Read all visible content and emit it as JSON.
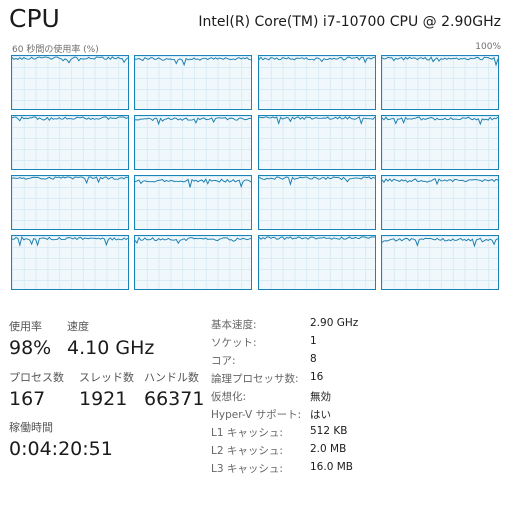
{
  "header": {
    "title": "CPU",
    "model": "Intel(R) Core(TM) i7-10700 CPU @ 2.90GHz",
    "graph_caption_left": "60 秒間の使用率 (%)",
    "graph_caption_right": "100%"
  },
  "graphs": {
    "rows": 4,
    "cols": 4,
    "line_color": "#1b7fb0",
    "border_color": "#1a84b8",
    "fill_color": "#f1f8fc",
    "levels_percent": [
      98,
      96,
      97,
      97,
      98,
      96,
      98,
      97,
      98,
      93,
      98,
      94,
      97,
      96,
      98,
      95
    ]
  },
  "stats": {
    "usage_label": "使用率",
    "usage_value": "98%",
    "speed_label": "速度",
    "speed_value": "4.10 GHz",
    "processes_label": "プロセス数",
    "processes_value": "167",
    "threads_label": "スレッド数",
    "threads_value": "1921",
    "handles_label": "ハンドル数",
    "handles_value": "66371",
    "uptime_label": "稼働時間",
    "uptime_value": "0:04:20:51"
  },
  "info": [
    {
      "key": "基本速度:",
      "value": "2.90 GHz"
    },
    {
      "key": "ソケット:",
      "value": "1"
    },
    {
      "key": "コア:",
      "value": "8"
    },
    {
      "key": "論理プロセッサ数:",
      "value": "16"
    },
    {
      "key": "仮想化:",
      "value": "無効"
    },
    {
      "key": "Hyper-V サポート:",
      "value": "はい"
    },
    {
      "key": "L1 キャッシュ:",
      "value": "512 KB"
    },
    {
      "key": "L2 キャッシュ:",
      "value": "2.0 MB"
    },
    {
      "key": "L3 キャッシュ:",
      "value": "16.0 MB"
    }
  ]
}
